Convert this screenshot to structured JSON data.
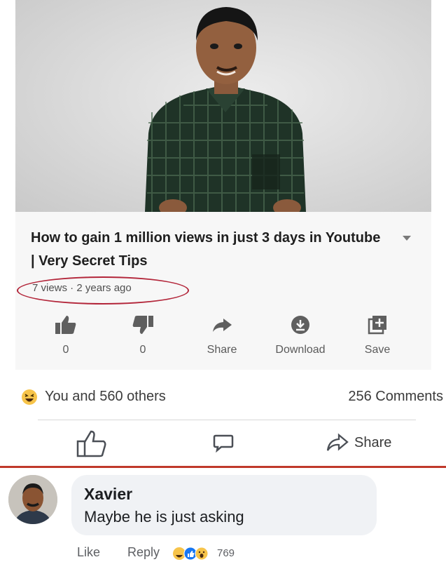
{
  "video": {
    "title": "How to gain 1 million views in just 3 days in Youtube | Very Secret Tips",
    "meta": "7 views · 2 years ago",
    "actions": [
      {
        "icon": "thumbs-up-icon",
        "label": "0"
      },
      {
        "icon": "thumbs-down-icon",
        "label": "0"
      },
      {
        "icon": "share-arrow-icon",
        "label": "Share"
      },
      {
        "icon": "download-icon",
        "label": "Download"
      },
      {
        "icon": "save-playlist-icon",
        "label": "Save"
      }
    ]
  },
  "post": {
    "reactions_text": "You and 560 others",
    "comments_count": "256 Comments",
    "share_label": "Share"
  },
  "comment": {
    "author": "Xavier",
    "text": "Maybe he is just asking",
    "like_label": "Like",
    "reply_label": "Reply",
    "reaction_count": "769"
  },
  "colors": {
    "highlight_red": "#b3263a",
    "haha_yellow": "#f7c44a",
    "like_blue": "#1877f2"
  }
}
